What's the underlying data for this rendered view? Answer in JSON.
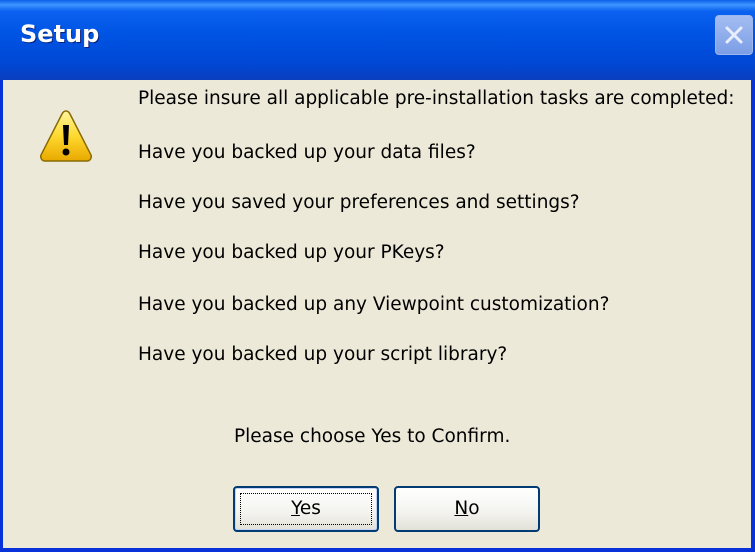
{
  "window": {
    "title": "Setup",
    "accent_color": "#0055E5",
    "background_color": "#ECE9D8"
  },
  "icon": {
    "name": "warning-icon"
  },
  "message": {
    "lines": [
      "Please insure all applicable pre-installation tasks are completed:",
      "Have you backed up your data files?",
      "Have you saved your preferences and settings?",
      "Have you backed up your PKeys?",
      "Have you backed up any Viewpoint customization?",
      "Have you backed up your script library?"
    ],
    "confirm": "Please choose Yes to Confirm."
  },
  "buttons": {
    "yes": {
      "mnemonic": "Y",
      "rest": "es"
    },
    "no": {
      "mnemonic": "N",
      "rest": "o"
    }
  }
}
